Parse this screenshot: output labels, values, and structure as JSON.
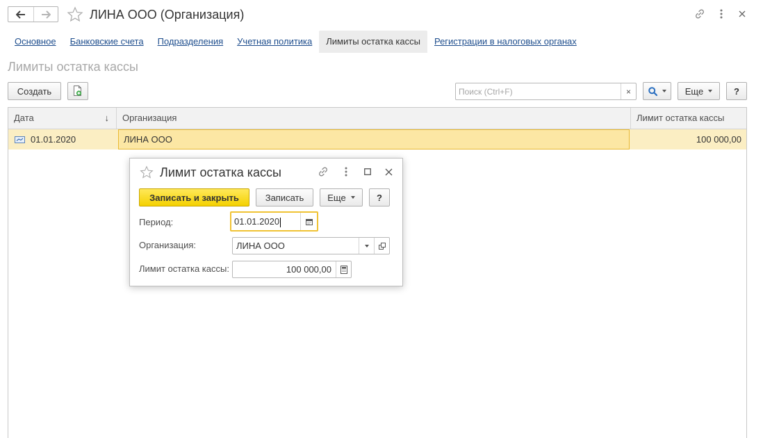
{
  "header": {
    "title": "ЛИНА ООО (Организация)",
    "back_icon": "arrow-left-icon",
    "forward_icon": "arrow-right-icon",
    "favorite_icon": "star-icon",
    "link_icon": "link-icon",
    "more_icon": "more-vertical-icon",
    "close_icon": "close-icon"
  },
  "tabs": [
    {
      "label": "Основное",
      "active": false
    },
    {
      "label": "Банковские счета",
      "active": false
    },
    {
      "label": "Подразделения",
      "active": false
    },
    {
      "label": "Учетная политика",
      "active": false
    },
    {
      "label": "Лимиты остатка кассы",
      "active": true
    },
    {
      "label": "Регистрации в налоговых органах",
      "active": false
    }
  ],
  "section_title": "Лимиты остатка кассы",
  "toolbar": {
    "create_label": "Создать",
    "copy_icon": "copy-document-icon",
    "search_placeholder": "Поиск (Ctrl+F)",
    "search_value": "",
    "clear_label": "×",
    "search_button_icon": "search-icon",
    "more_label": "Еще",
    "help_label": "?"
  },
  "table": {
    "columns": [
      "Дата",
      "Организация",
      "Лимит остатка кассы"
    ],
    "sort_indicator": "↓",
    "rows": [
      {
        "date": "01.01.2020",
        "organization": "ЛИНА ООО",
        "limit": "100 000,00"
      }
    ]
  },
  "dialog": {
    "title": "Лимит остатка кассы",
    "save_close_label": "Записать и закрыть",
    "save_label": "Записать",
    "more_label": "Еще",
    "help_label": "?",
    "fields": {
      "period_label": "Период:",
      "period_value": "01.01.2020",
      "organization_label": "Организация:",
      "organization_value": "ЛИНА ООО",
      "limit_label": "Лимит остатка кассы:",
      "limit_value": "100 000,00"
    }
  },
  "colors": {
    "accent_yellow": "#f4d100",
    "selected_row": "#fbeec3",
    "focus_border": "#f0c233",
    "link_blue": "#1c4c8c"
  }
}
